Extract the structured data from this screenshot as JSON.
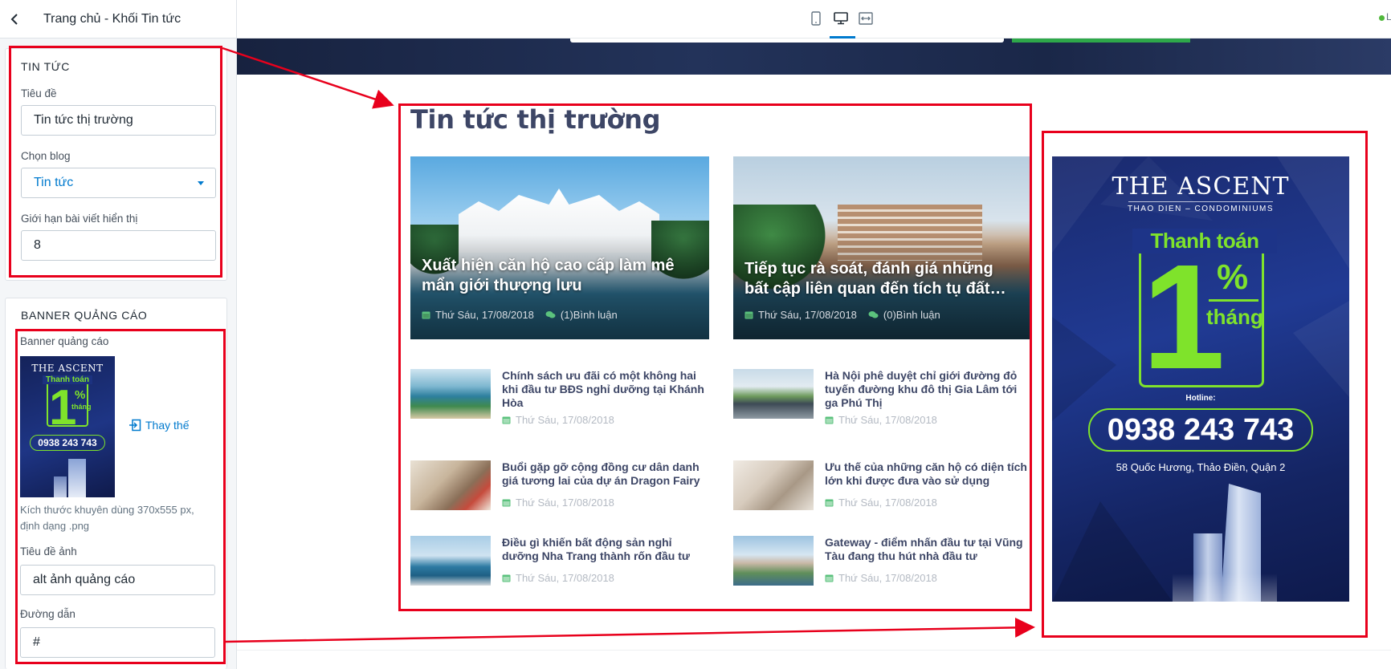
{
  "sidebar": {
    "header_title": "Trang chủ - Khối Tin tức",
    "news_card": {
      "title": "TIN TỨC",
      "title_label": "Tiêu đề",
      "title_value": "Tin tức thị trường",
      "blog_label": "Chọn blog",
      "blog_value": "Tin tức",
      "limit_label": "Giới hạn bài viết hiển thị",
      "limit_value": "8"
    },
    "banner_card": {
      "title": "BANNER QUẢNG CÁO",
      "banner_label": "Banner quảng cáo",
      "replace_label": "Thay thế",
      "hint": "Kích thước khuyên dùng 370x555 px, định dạng .png",
      "alt_label": "Tiêu đề ảnh",
      "alt_value": "alt ảnh quảng cáo",
      "link_label": "Đường dẫn",
      "link_value": "#"
    }
  },
  "toolbar": {
    "devices": [
      "mobile-icon",
      "desktop-icon",
      "fullwidth-icon"
    ],
    "active_device": "desktop-icon",
    "live_text": "L"
  },
  "preview": {
    "section_title": "Tin tức thị trường",
    "featured": [
      {
        "title": "Xuất hiện căn hộ cao cấp làm mê mẩn giới thượng lưu",
        "date": "Thứ Sáu, 17/08/2018",
        "comments": "(1)Bình luận"
      },
      {
        "title": "Tiếp tục rà soát, đánh giá những bất cập liên quan đến tích tụ đất…",
        "date": "Thứ Sáu, 17/08/2018",
        "comments": "(0)Bình luận"
      }
    ],
    "items": [
      {
        "title": "Chính sách ưu đãi có một không hai khi đầu tư BĐS nghỉ dưỡng tại Khánh Hòa",
        "date": "Thứ Sáu, 17/08/2018"
      },
      {
        "title": "Hà Nội phê duyệt chỉ giới đường đỏ tuyến đường khu đô thị Gia Lâm tới ga Phú Thị",
        "date": "Thứ Sáu, 17/08/2018"
      },
      {
        "title": "Buổi gặp gỡ cộng đồng cư dân danh giá tương lai của dự án Dragon Fairy",
        "date": "Thứ Sáu, 17/08/2018"
      },
      {
        "title": "Ưu thế của những căn hộ có diện tích lớn khi được đưa vào sử dụng",
        "date": "Thứ Sáu, 17/08/2018"
      },
      {
        "title": "Điều gì khiến bất động sản nghỉ dưỡng Nha Trang thành rốn đầu tư",
        "date": "Thứ Sáu, 17/08/2018"
      },
      {
        "title": "Gateway - điểm nhấn đầu tư tại Vũng Tàu đang thu hút nhà đầu tư",
        "date": "Thứ Sáu, 17/08/2018"
      }
    ],
    "banner": {
      "logo": "THE ASCENT",
      "subtitle": "THAO DIEN – CONDOMINIUMS",
      "pay": "Thanh toán",
      "one": "1",
      "percent": "%",
      "month": "tháng",
      "hotline_label": "Hotline:",
      "phone": "0938 243 743",
      "address": "58 Quốc Hương, Thảo Điền, Quận 2"
    }
  },
  "colors": {
    "accent": "#007ace",
    "highlight_red": "#e8001c",
    "news_title": "#3d4666",
    "banner_green": "#7fe32b",
    "date_icon_green": "#5bc27d"
  }
}
